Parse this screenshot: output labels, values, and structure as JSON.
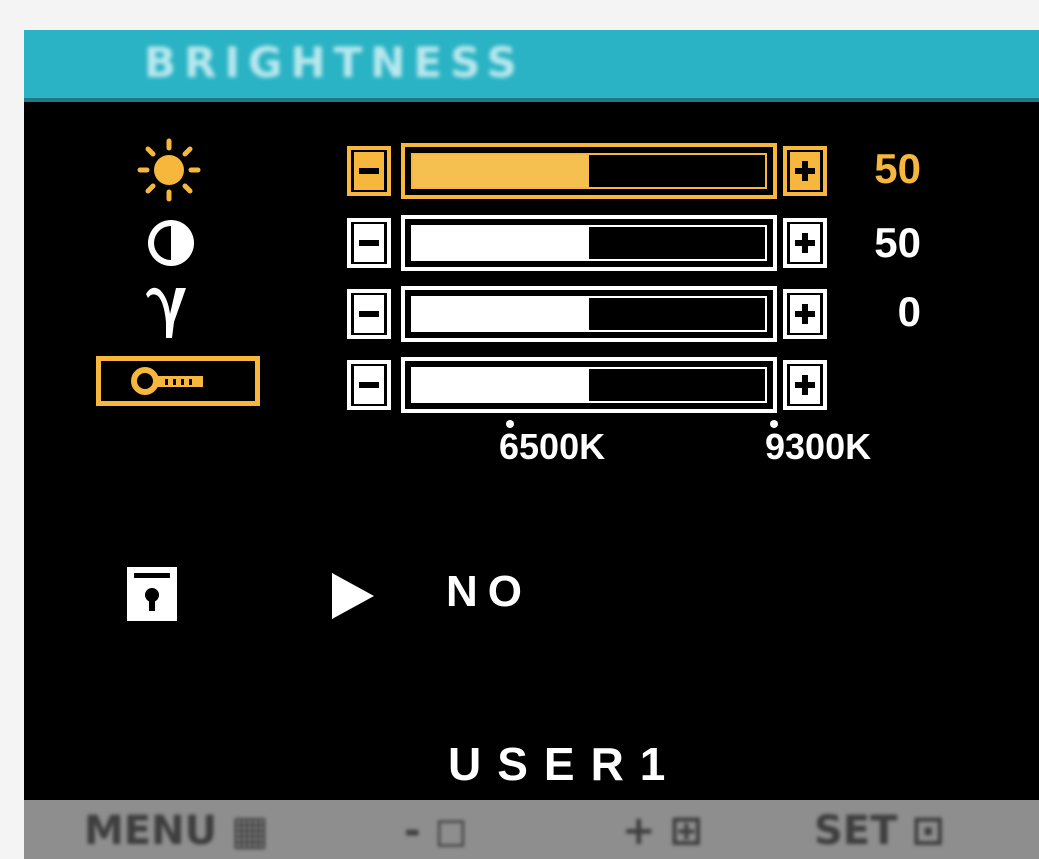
{
  "osd": {
    "title": "BRIGHTNESS",
    "colors": {
      "title_bar": "#2ab3c4",
      "accent": "#f6b73c",
      "background": "#000000"
    }
  },
  "adjustments": [
    {
      "icon": "sun-icon",
      "label_icon": "brightness",
      "value": "50",
      "level_percent": 50,
      "selected": true
    },
    {
      "icon": "contrast-icon",
      "label_icon": "contrast",
      "value": "50",
      "level_percent": 50,
      "selected": false
    },
    {
      "icon": "gamma-icon",
      "label_icon": "gamma",
      "value": "0",
      "level_percent": 50,
      "selected": false
    },
    {
      "icon": "color-temperature-key-icon",
      "label_icon": "color temperature",
      "value": "",
      "level_percent": 50,
      "selected": false
    }
  ],
  "color_temperature": {
    "low_label": "6500K",
    "high_label": "9300K"
  },
  "save": {
    "icon": "save-icon",
    "arrow_icon": "play-arrow-icon",
    "value": "NO"
  },
  "mode": "USER1",
  "bottom_bar": {
    "menu": "MENU",
    "minus": "-",
    "plus": "+",
    "set": "SET"
  }
}
